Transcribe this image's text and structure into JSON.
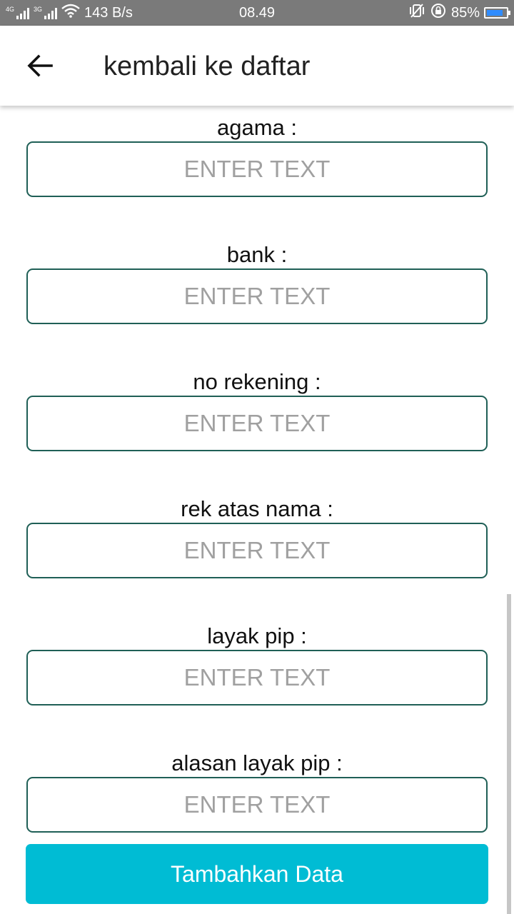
{
  "status_bar": {
    "network_1": "4G",
    "network_2": "3G",
    "speed": "143 B/s",
    "time": "08.49",
    "battery_percent": "85%",
    "battery_level": 0.85,
    "battery_color": "#2f8cff",
    "icons": [
      "signal-icon",
      "wifi-icon",
      "vibrate-icon",
      "rotation-lock-icon",
      "battery-icon"
    ]
  },
  "appbar": {
    "back_icon": "arrow-left-icon",
    "title": "kembali ke daftar"
  },
  "form": {
    "fields": [
      {
        "label": "agama :",
        "placeholder": "ENTER TEXT",
        "value": ""
      },
      {
        "label": "bank :",
        "placeholder": "ENTER TEXT",
        "value": ""
      },
      {
        "label": "no rekening :",
        "placeholder": "ENTER TEXT",
        "value": ""
      },
      {
        "label": "rek atas nama :",
        "placeholder": "ENTER TEXT",
        "value": ""
      },
      {
        "label": "layak pip :",
        "placeholder": "ENTER TEXT",
        "value": ""
      },
      {
        "label": "alasan layak pip :",
        "placeholder": "ENTER TEXT",
        "value": ""
      }
    ],
    "submit_label": "Tambahkan Data"
  },
  "colors": {
    "accent": "#00bcd4",
    "input_border": "#1f5f56",
    "status_bar": "#7a7a7a"
  }
}
